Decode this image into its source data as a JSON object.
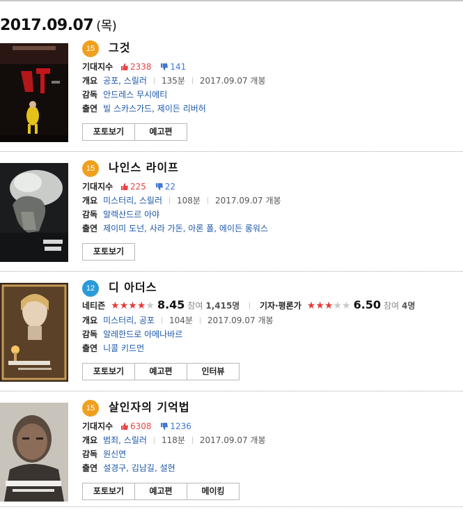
{
  "date": "2017.09.07",
  "day_of_week": "(목)",
  "labels": {
    "expect": "기대지수",
    "genre": "개요",
    "director": "감독",
    "cast": "출연",
    "netizen": "네티즌",
    "critic": "기자·평론가",
    "participants_prefix": "참여"
  },
  "colors": {
    "grade15": "#f0a01e",
    "grade12": "#2a9bd8",
    "link": "#1a56a8",
    "like": "#e64545",
    "dislike": "#3f78d0"
  },
  "movies": [
    {
      "grade": "15",
      "title": "그것",
      "likes": "2338",
      "dislikes": "141",
      "genre": "공포, 스릴러",
      "runtime": "135분",
      "release": "2017.09.07 개봉",
      "director": "안드레스 무시에티",
      "cast": "빌 스카스가드, 제이든 리버허",
      "buttons": [
        "포토보기",
        "예고편"
      ]
    },
    {
      "grade": "15",
      "title": "나인스 라이프",
      "likes": "225",
      "dislikes": "22",
      "genre": "미스터리, 스릴러",
      "runtime": "108분",
      "release": "2017.09.07 개봉",
      "director": "알렉산드르 아야",
      "cast": "제이미 도넌, 사라 가돈, 아론 폴, 에이든 롱워스",
      "buttons": [
        "포토보기"
      ]
    },
    {
      "grade": "12",
      "title": "디 아더스",
      "netizen_stars": 4,
      "netizen_score": "8.45",
      "netizen_count": "1,415명",
      "critic_stars": 3,
      "critic_score": "6.50",
      "critic_count": "4명",
      "genre": "미스터리, 공포",
      "runtime": "104분",
      "release": "2017.09.07 개봉",
      "director": "알레한드로 아메나바르",
      "cast": "니콜 키드먼",
      "buttons": [
        "포토보기",
        "예고편",
        "인터뷰"
      ]
    },
    {
      "grade": "15",
      "title": "살인자의 기억법",
      "likes": "6308",
      "dislikes": "1236",
      "genre": "범죄, 스릴러",
      "runtime": "118분",
      "release": "2017.09.07 개봉",
      "director": "원신연",
      "cast": "설경구, 김남길, 설현",
      "buttons": [
        "포토보기",
        "예고편",
        "메이킹"
      ]
    }
  ]
}
